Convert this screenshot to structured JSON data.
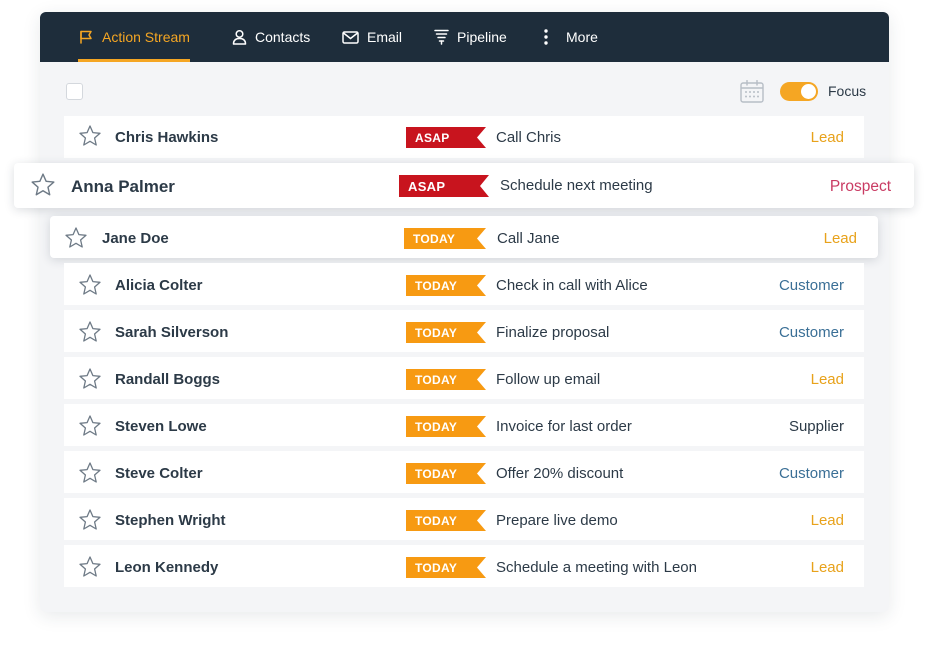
{
  "nav": {
    "tabs": [
      {
        "label": "Action Stream",
        "icon": "action-stream-icon",
        "active": true
      },
      {
        "label": "Contacts",
        "icon": "user-icon",
        "active": false
      },
      {
        "label": "Email",
        "icon": "envelope-icon",
        "active": false
      },
      {
        "label": "Pipeline",
        "icon": "funnel-icon",
        "active": false
      },
      {
        "label": "More",
        "icon": "more-vertical-icon",
        "active": false
      }
    ]
  },
  "toolbar": {
    "focus_label": "Focus",
    "focus_on": true
  },
  "colors": {
    "nav_bg": "#1e2d3b",
    "accent": "#f5a623",
    "asap": "#c8141e",
    "today": "#f79a12",
    "lead": "#e8a21b",
    "customer": "#3a6f96",
    "prospect": "#c93b63",
    "supplier": "#2c3a47"
  },
  "rows": [
    {
      "name": "Chris Hawkins",
      "badge": "ASAP",
      "task": "Call Chris",
      "relationship": "Lead"
    },
    {
      "name": "Anna Palmer",
      "badge": "ASAP",
      "task": "Schedule next meeting",
      "relationship": "Prospect"
    },
    {
      "name": "Jane Doe",
      "badge": "TODAY",
      "task": "Call Jane",
      "relationship": "Lead"
    },
    {
      "name": "Alicia Colter",
      "badge": "TODAY",
      "task": "Check in call with Alice",
      "relationship": "Customer"
    },
    {
      "name": "Sarah Silverson",
      "badge": "TODAY",
      "task": "Finalize proposal",
      "relationship": "Customer"
    },
    {
      "name": "Randall Boggs",
      "badge": "TODAY",
      "task": "Follow up email",
      "relationship": "Lead"
    },
    {
      "name": "Steven Lowe",
      "badge": "TODAY",
      "task": "Invoice for last order",
      "relationship": "Supplier"
    },
    {
      "name": "Steve Colter",
      "badge": "TODAY",
      "task": "Offer 20% discount",
      "relationship": "Customer"
    },
    {
      "name": "Stephen Wright",
      "badge": "TODAY",
      "task": "Prepare live demo",
      "relationship": "Lead"
    },
    {
      "name": "Leon Kennedy",
      "badge": "TODAY",
      "task": "Schedule a meeting with Leon",
      "relationship": "Lead"
    }
  ]
}
